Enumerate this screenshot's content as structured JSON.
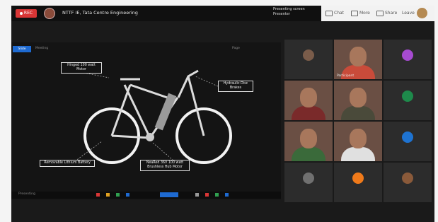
{
  "topbar": {
    "rec_label": "REC",
    "title": "NTTF IE, Tata Centre Engineering",
    "presenter_line1": "Presenting screen",
    "presenter_line2": "Presenter",
    "buttons": [
      "Chat",
      "More",
      "Share",
      "Leave"
    ]
  },
  "share": {
    "tag": "Slide",
    "header": "Meeting",
    "header_right": "Page",
    "callouts": [
      "Hinged 100 watt Motor",
      "Hydraulic Disc Brakes",
      "Removable Lithium Battery",
      "NeaRed 36V 100 watt Brushless Hub Motor"
    ]
  },
  "statusbar": {
    "label": "Presenting"
  },
  "participants": [
    {
      "kind": "avatar",
      "name": "",
      "color": "#7a5c4a"
    },
    {
      "kind": "video",
      "name": "Participant",
      "shirt": "#c94b3a"
    },
    {
      "kind": "avatar",
      "name": "",
      "color": "#a64bd1"
    },
    {
      "kind": "video",
      "name": "",
      "shirt": "#7a2a2a"
    },
    {
      "kind": "video",
      "name": "",
      "shirt": "#4a4a3a"
    },
    {
      "kind": "avatar",
      "name": "",
      "color": "#1e8a4b"
    },
    {
      "kind": "video",
      "name": "",
      "shirt": "#3a6a3a"
    },
    {
      "kind": "video",
      "name": "",
      "shirt": "#e0e0e0"
    },
    {
      "kind": "avatar",
      "name": "",
      "color": "#1e73d1"
    },
    {
      "kind": "avatar",
      "name": "",
      "color": "#707070"
    },
    {
      "kind": "avatar",
      "name": "",
      "color": "#f07a1a"
    },
    {
      "kind": "avatar",
      "name": "",
      "color": "#8a5a3a"
    }
  ],
  "colors": {
    "accent": "#1e6ad1",
    "record": "#d93636"
  }
}
